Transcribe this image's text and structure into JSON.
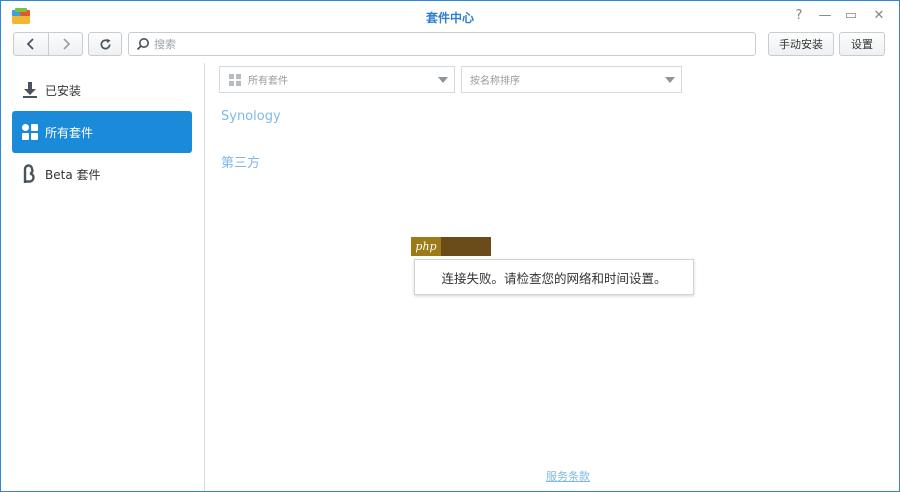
{
  "window": {
    "title": "套件中心"
  },
  "title_buttons": {
    "help": "?",
    "minimize": "—",
    "maximize": "▭",
    "close": "✕"
  },
  "toolbar": {
    "back_icon": "chevron-left-icon",
    "forward_icon": "chevron-right-icon",
    "refresh_icon": "refresh-icon",
    "search_placeholder": "搜索",
    "search_value": "",
    "manual_install_label": "手动安装",
    "settings_label": "设置"
  },
  "sidebar": {
    "items": [
      {
        "label": "已安装",
        "icon": "download-icon",
        "active": false
      },
      {
        "label": "所有套件",
        "icon": "grid-icon",
        "active": true
      },
      {
        "label": "Beta 套件",
        "icon": "beta-icon",
        "active": false
      }
    ]
  },
  "filters": {
    "category_selected": "所有套件",
    "sort_selected": "按名称排序"
  },
  "sections": {
    "synology": "Synology",
    "third_party": "第三方"
  },
  "message": {
    "error_text": "连接失败。请检查您的网络和时间设置。",
    "watermark_text": "php"
  },
  "footer": {
    "terms_link": "服务条款"
  },
  "colors": {
    "accent": "#1b8ad9",
    "title_color": "#2f7fd0",
    "section_link": "#7fb9e8",
    "window_border": "#2e86d9"
  }
}
